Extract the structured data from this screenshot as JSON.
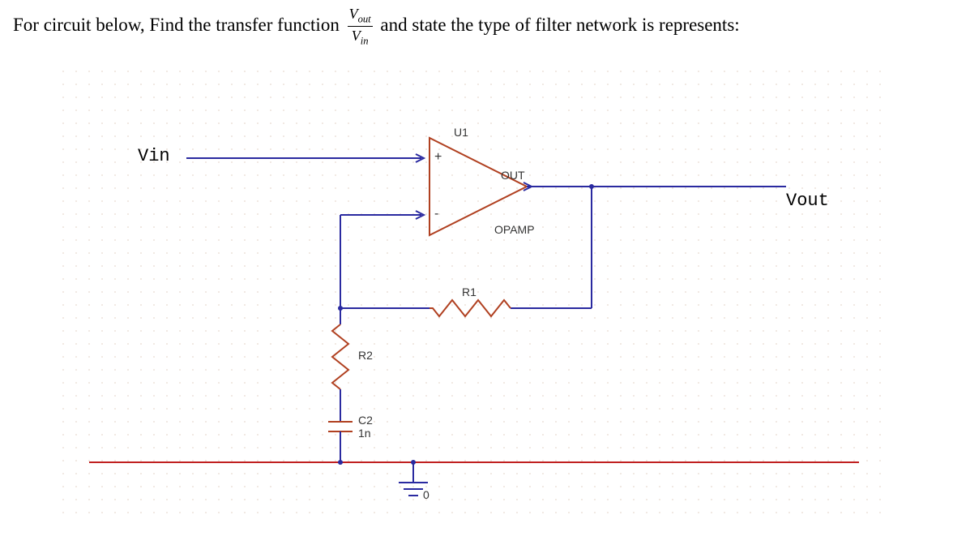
{
  "question": {
    "prefix": "For circuit below, Find the transfer function ",
    "frac_num": "V",
    "frac_num_sub": "out",
    "frac_den": "V",
    "frac_den_sub": "in",
    "suffix": " and state the type of filter network is represents:"
  },
  "labels": {
    "vin": "Vin",
    "vout": "Vout",
    "u1": "U1",
    "out": "OUT",
    "opamp": "OPAMP",
    "r1": "R1",
    "r2": "R2",
    "c2": "C2",
    "c2_val": "1n",
    "gnd": "0",
    "plus": "+",
    "minus": "-"
  }
}
